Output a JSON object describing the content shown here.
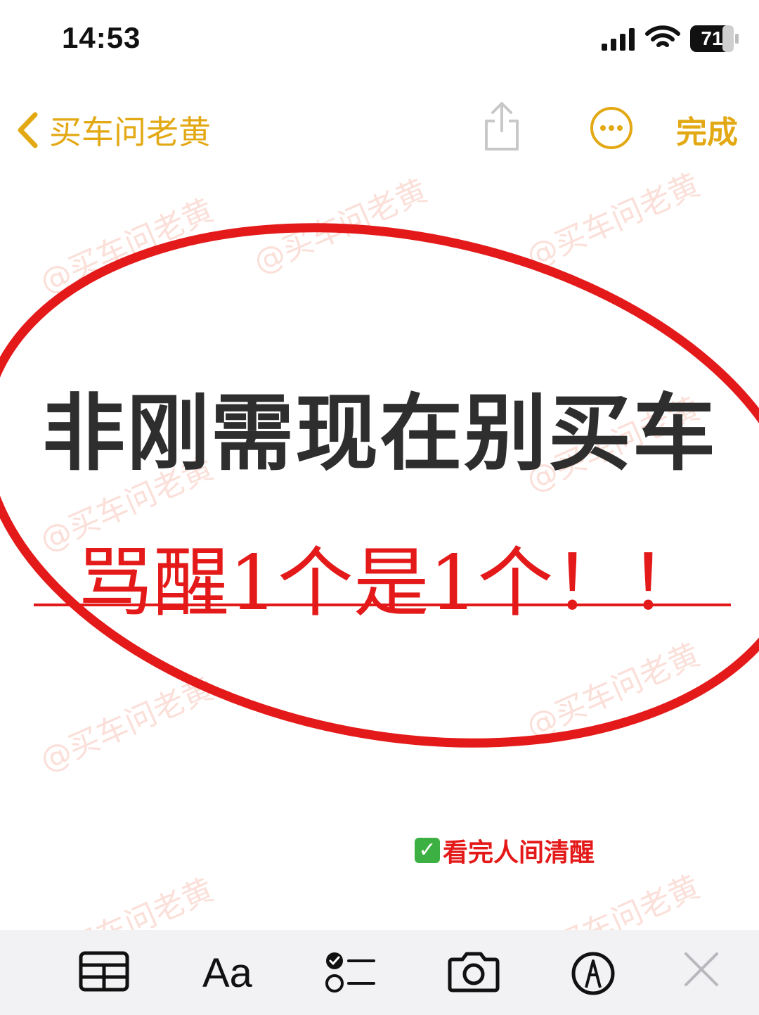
{
  "status_bar": {
    "time": "14:53",
    "battery": "71"
  },
  "nav": {
    "back_label": "买车问老黄",
    "done_label": "完成"
  },
  "content": {
    "headline": "非刚需现在别买车",
    "subheadline": "骂醒1个是1个！！",
    "footer_note": "看完人间清醒",
    "watermark": "@买车问老黄"
  },
  "toolbar": {
    "text_format_label": "Aa"
  },
  "colors": {
    "accent": "#e3a914",
    "red": "#e41a1a",
    "headline": "#2e2e2e",
    "toolbar_bg": "#f2f2f5"
  }
}
